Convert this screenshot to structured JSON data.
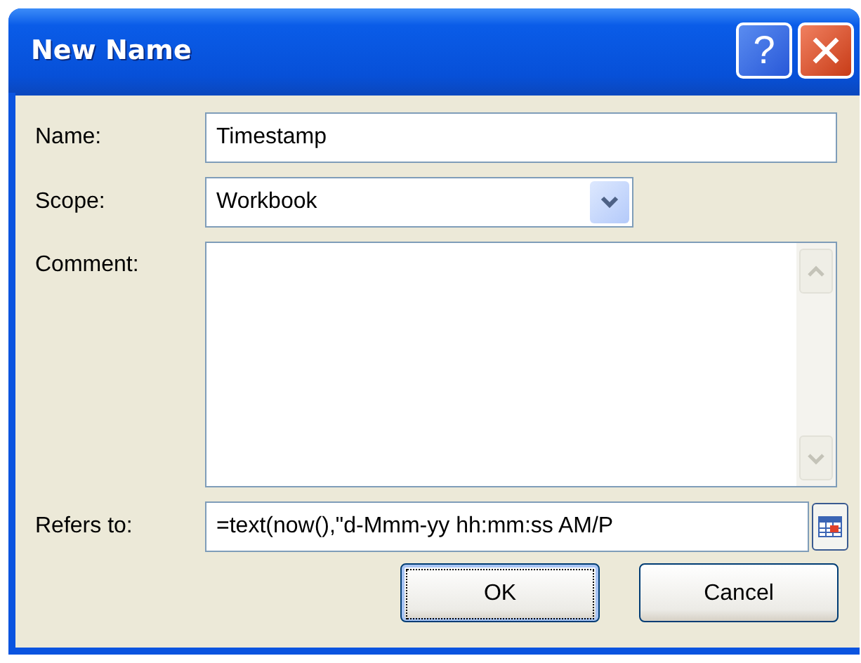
{
  "window": {
    "title": "New Name",
    "help_button": "?"
  },
  "fields": [
    {
      "kind": "text",
      "label": "Name:",
      "value": "Timestamp"
    },
    {
      "kind": "dropdown",
      "label": "Scope:",
      "value": "Workbook"
    },
    {
      "kind": "textarea",
      "label": "Comment:"
    },
    {
      "kind": "reference",
      "label": "Refers to:",
      "value": "=text(now(),\"d-Mmm-yy hh:mm:ss AM/P"
    }
  ],
  "buttons": [
    {
      "label": "OK",
      "focused": true
    },
    {
      "label": "Cancel",
      "focused": false
    }
  ]
}
